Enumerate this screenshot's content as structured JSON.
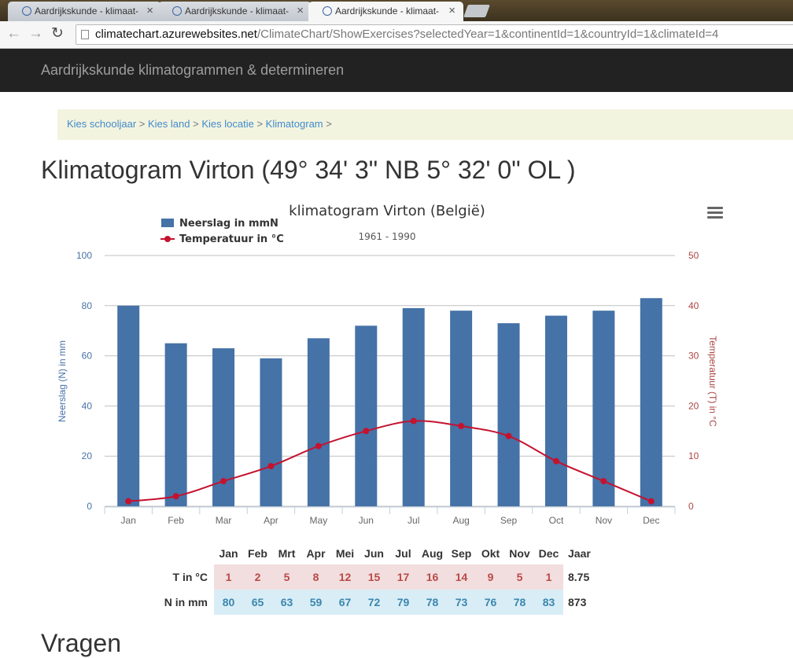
{
  "browser": {
    "tabs": [
      {
        "title": "Aardrijkskunde - klimaat-",
        "active": false
      },
      {
        "title": "Aardrijkskunde - klimaat-",
        "active": false
      },
      {
        "title": "Aardrijkskunde - klimaat-",
        "active": true
      }
    ],
    "url_host": "climatechart.azurewebsites.net",
    "url_path": "/ClimateChart/ShowExercises?selectedYear=1&continentId=1&countryId=1&climateId=4"
  },
  "header": {
    "brand": "Aardrijkskunde klimatogrammen & determineren"
  },
  "breadcrumb": {
    "items": [
      "Kies schooljaar",
      "Kies land",
      "Kies locatie",
      "Klimatogram"
    ],
    "separator": ">"
  },
  "page": {
    "title": "Klimatogram Virton (49° 34' 3\" NB 5° 32' 0\" OL )",
    "next_heading": "Vragen"
  },
  "chart_data": {
    "type": "bar+line",
    "title": "klimatogram Virton (België)",
    "subtitle": "1961 - 1990",
    "categories": [
      "Jan",
      "Feb",
      "Mar",
      "Apr",
      "May",
      "Jun",
      "Jul",
      "Aug",
      "Sep",
      "Oct",
      "Nov",
      "Dec"
    ],
    "series": [
      {
        "name": "Neerslag in mmN",
        "type": "bar",
        "axis": "left",
        "color": "#4572a7",
        "values": [
          80,
          65,
          63,
          59,
          67,
          72,
          79,
          78,
          73,
          76,
          78,
          83
        ]
      },
      {
        "name": "Temperatuur in °C",
        "type": "line",
        "axis": "right",
        "color": "#c4122f",
        "values": [
          1,
          2,
          5,
          8,
          12,
          15,
          17,
          16,
          14,
          9,
          5,
          1
        ]
      }
    ],
    "y_left": {
      "label": "Neerslag (N) in mm",
      "range": [
        0,
        100
      ],
      "ticks": [
        0,
        20,
        40,
        60,
        80,
        100
      ],
      "color": "#4572a7"
    },
    "y_right": {
      "label": "Temperatuur (T) in °C",
      "range": [
        0,
        50
      ],
      "ticks": [
        0,
        10,
        20,
        30,
        40,
        50
      ],
      "color": "#aa4643"
    },
    "legend": "top-left",
    "grid": true
  },
  "table": {
    "months": [
      "Jan",
      "Feb",
      "Mrt",
      "Apr",
      "Mei",
      "Jun",
      "Jul",
      "Aug",
      "Sep",
      "Okt",
      "Nov",
      "Dec"
    ],
    "year_header": "Jaar",
    "t_label": "T in °C",
    "n_label": "N in mm",
    "temperatures": [
      "1",
      "2",
      "5",
      "8",
      "12",
      "15",
      "17",
      "16",
      "14",
      "9",
      "5",
      "1"
    ],
    "precipitation": [
      "80",
      "65",
      "63",
      "59",
      "67",
      "72",
      "79",
      "78",
      "73",
      "76",
      "78",
      "83"
    ],
    "t_year": "8.75",
    "n_year": "873"
  }
}
